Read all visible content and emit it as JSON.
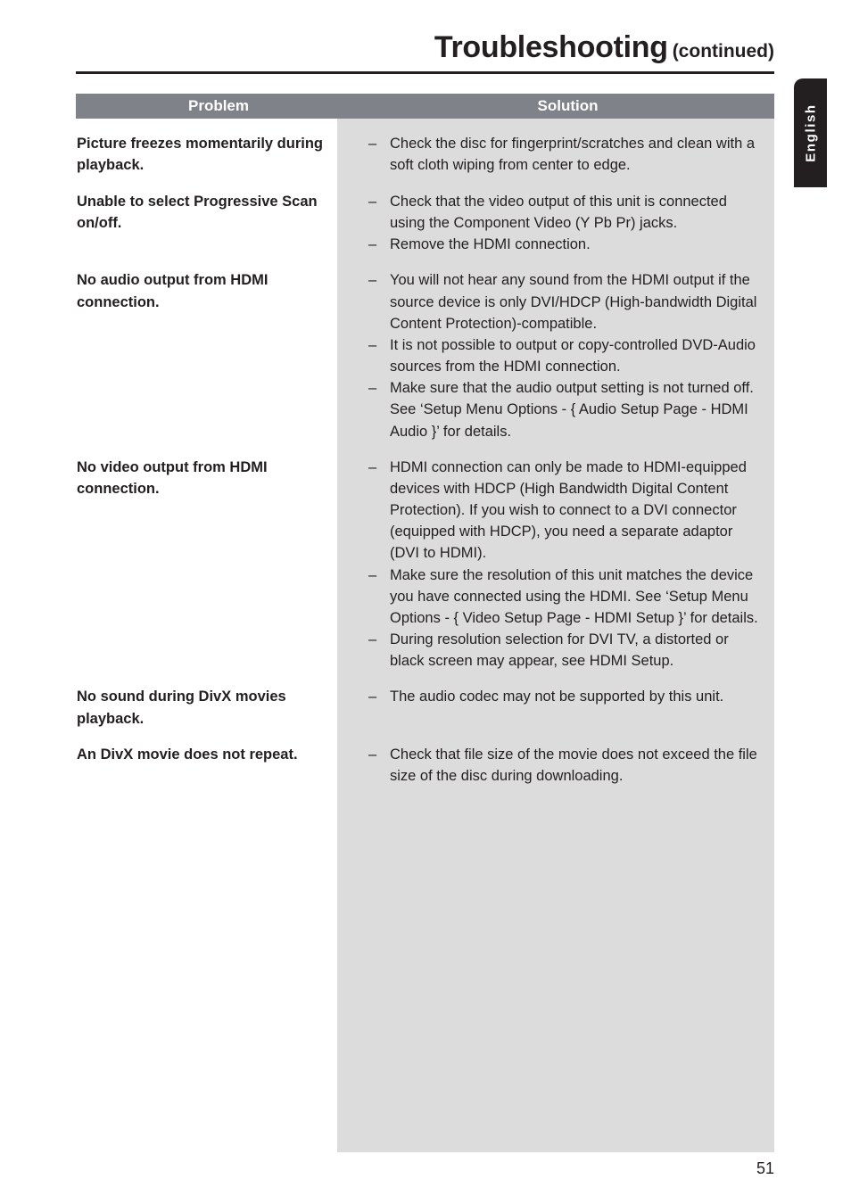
{
  "header": {
    "title": "Troubleshooting",
    "title_suffix": "(continued)"
  },
  "language_tab": {
    "label": "English"
  },
  "table": {
    "columns": {
      "problem": "Problem",
      "solution": "Solution"
    },
    "rows": [
      {
        "problem": "Picture freezes momentarily during playback.",
        "solutions": [
          "Check the disc for fingerprint/scratches and clean with a soft cloth wiping from center to edge."
        ]
      },
      {
        "problem": "Unable to select Progressive Scan on/off.",
        "solutions": [
          "Check that the video output of this unit is connected using the Component Video (Y Pb Pr) jacks.",
          "Remove the HDMI connection."
        ]
      },
      {
        "problem": "No audio output from HDMI connection.",
        "solutions": [
          "You will not hear any sound from the HDMI output if the source device is only DVI/HDCP (High-bandwidth Digital Content Protection)-compatible.",
          "It is not possible to output or copy-controlled DVD-Audio sources from the HDMI connection.",
          "Make sure that the audio output setting is not turned off. See ‘Setup Menu Options - { Audio Setup Page - HDMI Audio }’ for details."
        ]
      },
      {
        "problem": "No video output from HDMI connection.",
        "solutions": [
          "HDMI connection can only be made to HDMI-equipped devices with HDCP (High Bandwidth Digital Content Protection). If you wish to connect to a DVI connector (equipped with HDCP), you need a separate adaptor (DVI to HDMI).",
          "Make sure the resolution of this unit matches the device you have connected using the HDMI. See ‘Setup Menu Options - { Video Setup Page - HDMI Setup }’ for details.",
          "During resolution selection for DVI TV, a distorted or black screen may appear, see HDMI Setup."
        ]
      },
      {
        "problem": "No sound during DivX movies playback.",
        "solutions": [
          "The audio codec may not be supported by this unit."
        ]
      },
      {
        "problem": "An DivX movie does not repeat.",
        "solutions": [
          "Check that file size of the movie does not exceed the file size of the disc during downloading."
        ]
      }
    ],
    "bullet_marker": "–"
  },
  "footer": {
    "page_number": "51"
  },
  "colors": {
    "header_bar": "#808289",
    "solution_background": "#dcdcdd",
    "text": "#231f20",
    "tab_background": "#231f20"
  }
}
